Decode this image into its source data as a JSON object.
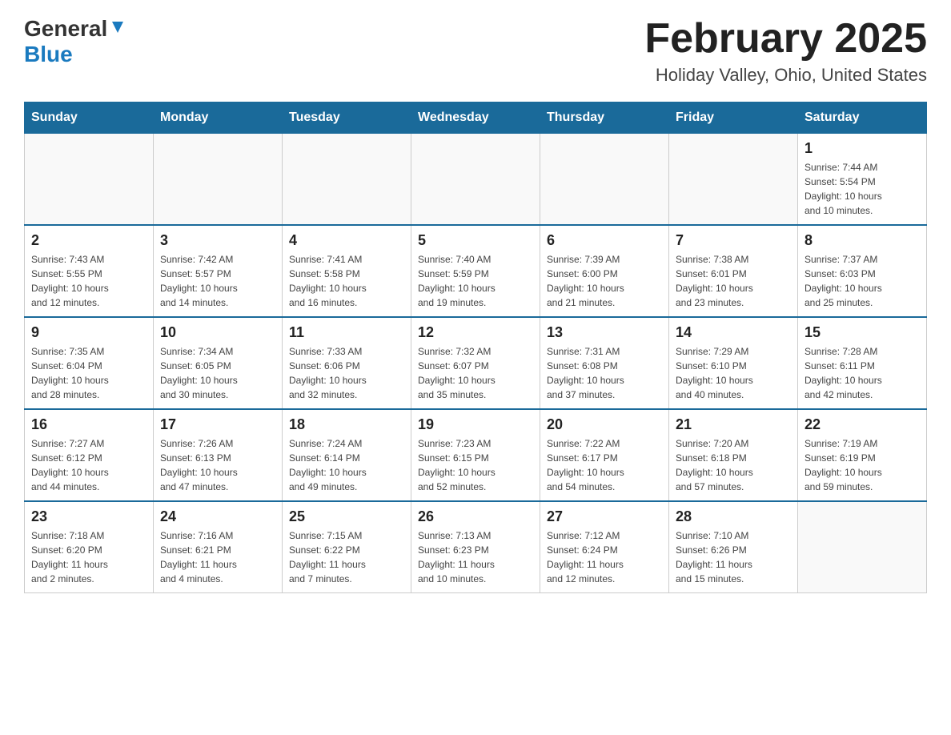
{
  "header": {
    "logo_general": "General",
    "logo_blue": "Blue",
    "month_title": "February 2025",
    "location": "Holiday Valley, Ohio, United States"
  },
  "calendar": {
    "days_of_week": [
      "Sunday",
      "Monday",
      "Tuesday",
      "Wednesday",
      "Thursday",
      "Friday",
      "Saturday"
    ],
    "weeks": [
      [
        {
          "day": "",
          "info": ""
        },
        {
          "day": "",
          "info": ""
        },
        {
          "day": "",
          "info": ""
        },
        {
          "day": "",
          "info": ""
        },
        {
          "day": "",
          "info": ""
        },
        {
          "day": "",
          "info": ""
        },
        {
          "day": "1",
          "info": "Sunrise: 7:44 AM\nSunset: 5:54 PM\nDaylight: 10 hours\nand 10 minutes."
        }
      ],
      [
        {
          "day": "2",
          "info": "Sunrise: 7:43 AM\nSunset: 5:55 PM\nDaylight: 10 hours\nand 12 minutes."
        },
        {
          "day": "3",
          "info": "Sunrise: 7:42 AM\nSunset: 5:57 PM\nDaylight: 10 hours\nand 14 minutes."
        },
        {
          "day": "4",
          "info": "Sunrise: 7:41 AM\nSunset: 5:58 PM\nDaylight: 10 hours\nand 16 minutes."
        },
        {
          "day": "5",
          "info": "Sunrise: 7:40 AM\nSunset: 5:59 PM\nDaylight: 10 hours\nand 19 minutes."
        },
        {
          "day": "6",
          "info": "Sunrise: 7:39 AM\nSunset: 6:00 PM\nDaylight: 10 hours\nand 21 minutes."
        },
        {
          "day": "7",
          "info": "Sunrise: 7:38 AM\nSunset: 6:01 PM\nDaylight: 10 hours\nand 23 minutes."
        },
        {
          "day": "8",
          "info": "Sunrise: 7:37 AM\nSunset: 6:03 PM\nDaylight: 10 hours\nand 25 minutes."
        }
      ],
      [
        {
          "day": "9",
          "info": "Sunrise: 7:35 AM\nSunset: 6:04 PM\nDaylight: 10 hours\nand 28 minutes."
        },
        {
          "day": "10",
          "info": "Sunrise: 7:34 AM\nSunset: 6:05 PM\nDaylight: 10 hours\nand 30 minutes."
        },
        {
          "day": "11",
          "info": "Sunrise: 7:33 AM\nSunset: 6:06 PM\nDaylight: 10 hours\nand 32 minutes."
        },
        {
          "day": "12",
          "info": "Sunrise: 7:32 AM\nSunset: 6:07 PM\nDaylight: 10 hours\nand 35 minutes."
        },
        {
          "day": "13",
          "info": "Sunrise: 7:31 AM\nSunset: 6:08 PM\nDaylight: 10 hours\nand 37 minutes."
        },
        {
          "day": "14",
          "info": "Sunrise: 7:29 AM\nSunset: 6:10 PM\nDaylight: 10 hours\nand 40 minutes."
        },
        {
          "day": "15",
          "info": "Sunrise: 7:28 AM\nSunset: 6:11 PM\nDaylight: 10 hours\nand 42 minutes."
        }
      ],
      [
        {
          "day": "16",
          "info": "Sunrise: 7:27 AM\nSunset: 6:12 PM\nDaylight: 10 hours\nand 44 minutes."
        },
        {
          "day": "17",
          "info": "Sunrise: 7:26 AM\nSunset: 6:13 PM\nDaylight: 10 hours\nand 47 minutes."
        },
        {
          "day": "18",
          "info": "Sunrise: 7:24 AM\nSunset: 6:14 PM\nDaylight: 10 hours\nand 49 minutes."
        },
        {
          "day": "19",
          "info": "Sunrise: 7:23 AM\nSunset: 6:15 PM\nDaylight: 10 hours\nand 52 minutes."
        },
        {
          "day": "20",
          "info": "Sunrise: 7:22 AM\nSunset: 6:17 PM\nDaylight: 10 hours\nand 54 minutes."
        },
        {
          "day": "21",
          "info": "Sunrise: 7:20 AM\nSunset: 6:18 PM\nDaylight: 10 hours\nand 57 minutes."
        },
        {
          "day": "22",
          "info": "Sunrise: 7:19 AM\nSunset: 6:19 PM\nDaylight: 10 hours\nand 59 minutes."
        }
      ],
      [
        {
          "day": "23",
          "info": "Sunrise: 7:18 AM\nSunset: 6:20 PM\nDaylight: 11 hours\nand 2 minutes."
        },
        {
          "day": "24",
          "info": "Sunrise: 7:16 AM\nSunset: 6:21 PM\nDaylight: 11 hours\nand 4 minutes."
        },
        {
          "day": "25",
          "info": "Sunrise: 7:15 AM\nSunset: 6:22 PM\nDaylight: 11 hours\nand 7 minutes."
        },
        {
          "day": "26",
          "info": "Sunrise: 7:13 AM\nSunset: 6:23 PM\nDaylight: 11 hours\nand 10 minutes."
        },
        {
          "day": "27",
          "info": "Sunrise: 7:12 AM\nSunset: 6:24 PM\nDaylight: 11 hours\nand 12 minutes."
        },
        {
          "day": "28",
          "info": "Sunrise: 7:10 AM\nSunset: 6:26 PM\nDaylight: 11 hours\nand 15 minutes."
        },
        {
          "day": "",
          "info": ""
        }
      ]
    ]
  }
}
